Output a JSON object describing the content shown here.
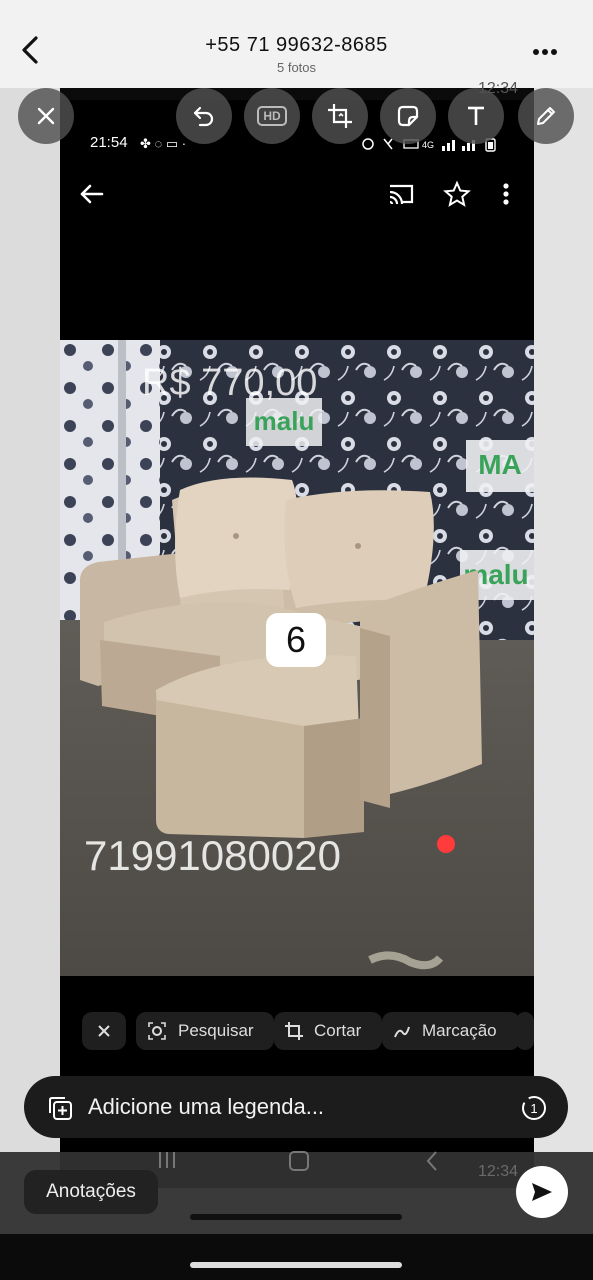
{
  "header": {
    "contact": "+55 71 99632-8685",
    "subtitle": "5 fotos",
    "time_bg": "12:34"
  },
  "tools": [
    "close-icon",
    "undo-icon",
    "hd-icon",
    "crop-rotate-icon",
    "sticker-icon",
    "text-icon",
    "pencil-icon"
  ],
  "hd_label": "HD",
  "inner_status": {
    "time": "21:54"
  },
  "photo": {
    "price": "R$ 770,00",
    "brand": "malu",
    "phone_watermark": "71991080020",
    "badge": "6"
  },
  "lens": {
    "search": "Pesquisar",
    "crop": "Cortar",
    "markup": "Marcação"
  },
  "caption": {
    "placeholder": "Adicione uma legenda..."
  },
  "annotations_label": "Anotações",
  "bottom_time": "12:34",
  "colors": {
    "recording_dot": "#ff3b3b"
  }
}
